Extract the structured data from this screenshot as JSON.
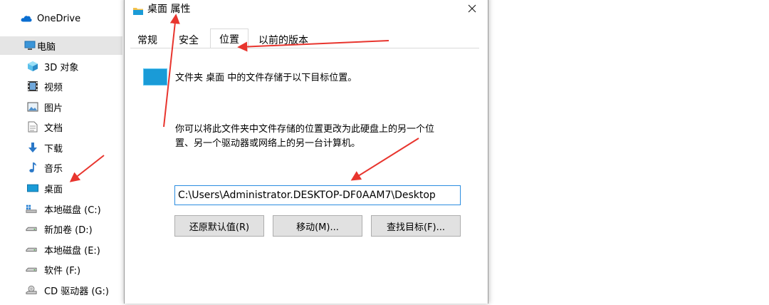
{
  "nav": {
    "items": [
      {
        "label": "OneDrive",
        "icon": "cloud-icon",
        "selected": false
      },
      {
        "label": "电脑",
        "icon": "computer-icon",
        "selected": true
      },
      {
        "label": "3D 对象",
        "icon": "cube-icon",
        "selected": false
      },
      {
        "label": "视频",
        "icon": "video-icon",
        "selected": false
      },
      {
        "label": "图片",
        "icon": "picture-icon",
        "selected": false
      },
      {
        "label": "文档",
        "icon": "document-icon",
        "selected": false
      },
      {
        "label": "下载",
        "icon": "download-icon",
        "selected": false
      },
      {
        "label": "音乐",
        "icon": "music-icon",
        "selected": false
      },
      {
        "label": "桌面",
        "icon": "desktop-icon",
        "selected": false
      },
      {
        "label": "本地磁盘 (C:)",
        "icon": "system-drive-icon",
        "selected": false
      },
      {
        "label": "新加卷 (D:)",
        "icon": "drive-icon",
        "selected": false
      },
      {
        "label": "本地磁盘 (E:)",
        "icon": "drive-icon",
        "selected": false
      },
      {
        "label": "软件 (F:)",
        "icon": "drive-icon",
        "selected": false
      },
      {
        "label": "CD 驱动器 (G:)",
        "icon": "cd-drive-icon",
        "selected": false
      }
    ]
  },
  "dialog": {
    "title": "桌面 属性",
    "tabs": [
      {
        "label": "常规",
        "active": false
      },
      {
        "label": "安全",
        "active": false
      },
      {
        "label": "位置",
        "active": true
      },
      {
        "label": "以前的版本",
        "active": false
      }
    ],
    "info_text": "文件夹 桌面 中的文件存储于以下目标位置。",
    "description_lines": [
      "你可以将此文件夹中文件存储的位置更改为此硬盘上的另一个位",
      "置、另一个驱动器或网络上的另一台计算机。"
    ],
    "path_value": "C:\\Users\\Administrator.DESKTOP-DF0AAM7\\Desktop",
    "buttons": {
      "restore_default": "还原默认值(R)",
      "move": "移动(M)...",
      "find_target": "查找目标(F)..."
    }
  },
  "colors": {
    "folder_blue": "#1a9bd7",
    "annotation_red": "#e8352e",
    "nav_selected": "#e5e5e5",
    "focus_blue": "#2b8de0"
  }
}
